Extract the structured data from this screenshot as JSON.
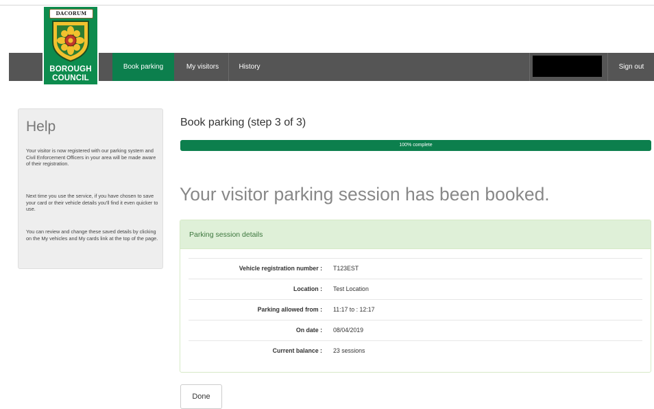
{
  "logo": {
    "banner": "DACORUM",
    "line1": "BOROUGH",
    "line2": "COUNCIL",
    "colors": {
      "green": "#0d8c4e",
      "gold": "#f2c12e",
      "red": "#c0392b"
    }
  },
  "nav": {
    "items": [
      {
        "label": "Book parking",
        "active": true
      },
      {
        "label": "My visitors",
        "active": false
      },
      {
        "label": "History",
        "active": false
      }
    ],
    "sign_out": "Sign out",
    "colors": {
      "bar": "#555555",
      "active": "#0c7f4d"
    }
  },
  "help": {
    "title": "Help",
    "paragraphs": [
      "Your visitor is now registered with our parking system and Civil Enforcement Officers in your area will be made aware of their registration.",
      "Next time you use the service, if you have chosen to save your card or their vehicle details you'll find it even quicker to use.",
      "You can review and change these saved details by clicking on the My vehicles and My cards link at the top of the page."
    ]
  },
  "main": {
    "step_title": "Book parking (step 3 of 3)",
    "progress": {
      "value": 100,
      "label": "100% complete"
    },
    "booked_title": "Your visitor parking session has been booked.",
    "panel": {
      "heading": "Parking session details",
      "rows": [
        {
          "label": "Vehicle registration number :",
          "value": "T123EST"
        },
        {
          "label": "Location :",
          "value": "Test Location"
        },
        {
          "label": "Parking allowed from :",
          "value": "11:17 to : 12:17"
        },
        {
          "label": "On date :",
          "value": "08/04/2019"
        },
        {
          "label": "Current balance :",
          "value": "23 sessions"
        }
      ]
    },
    "done_label": "Done"
  }
}
